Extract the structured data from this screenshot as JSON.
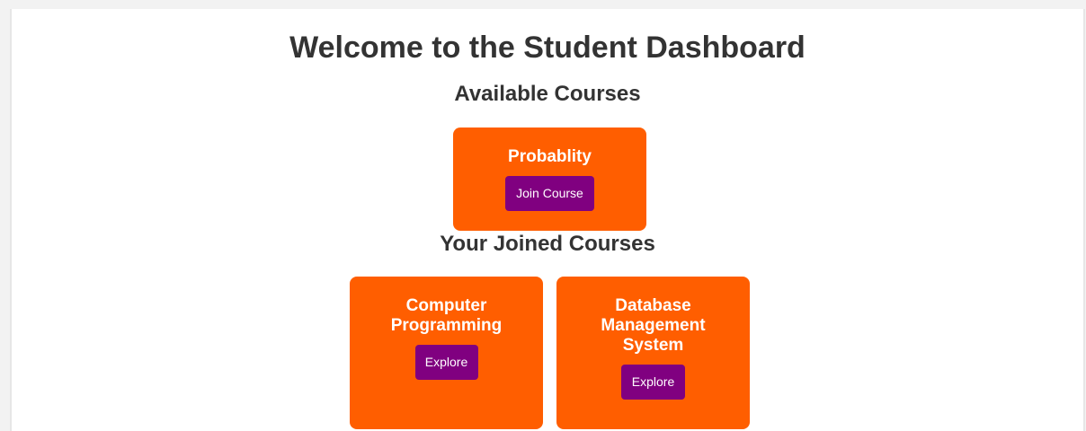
{
  "page": {
    "title": "Welcome to the Student Dashboard"
  },
  "available": {
    "heading": "Available Courses",
    "courses": [
      {
        "name": "Probablity",
        "button": "Join Course"
      }
    ]
  },
  "joined": {
    "heading": "Your Joined Courses",
    "courses": [
      {
        "name": "Computer Programming",
        "button": "Explore"
      },
      {
        "name": "Database Management System",
        "button": "Explore"
      }
    ]
  },
  "colors": {
    "card_background": "#ff5e00",
    "button_background": "#800080",
    "heading_text": "#333333"
  }
}
